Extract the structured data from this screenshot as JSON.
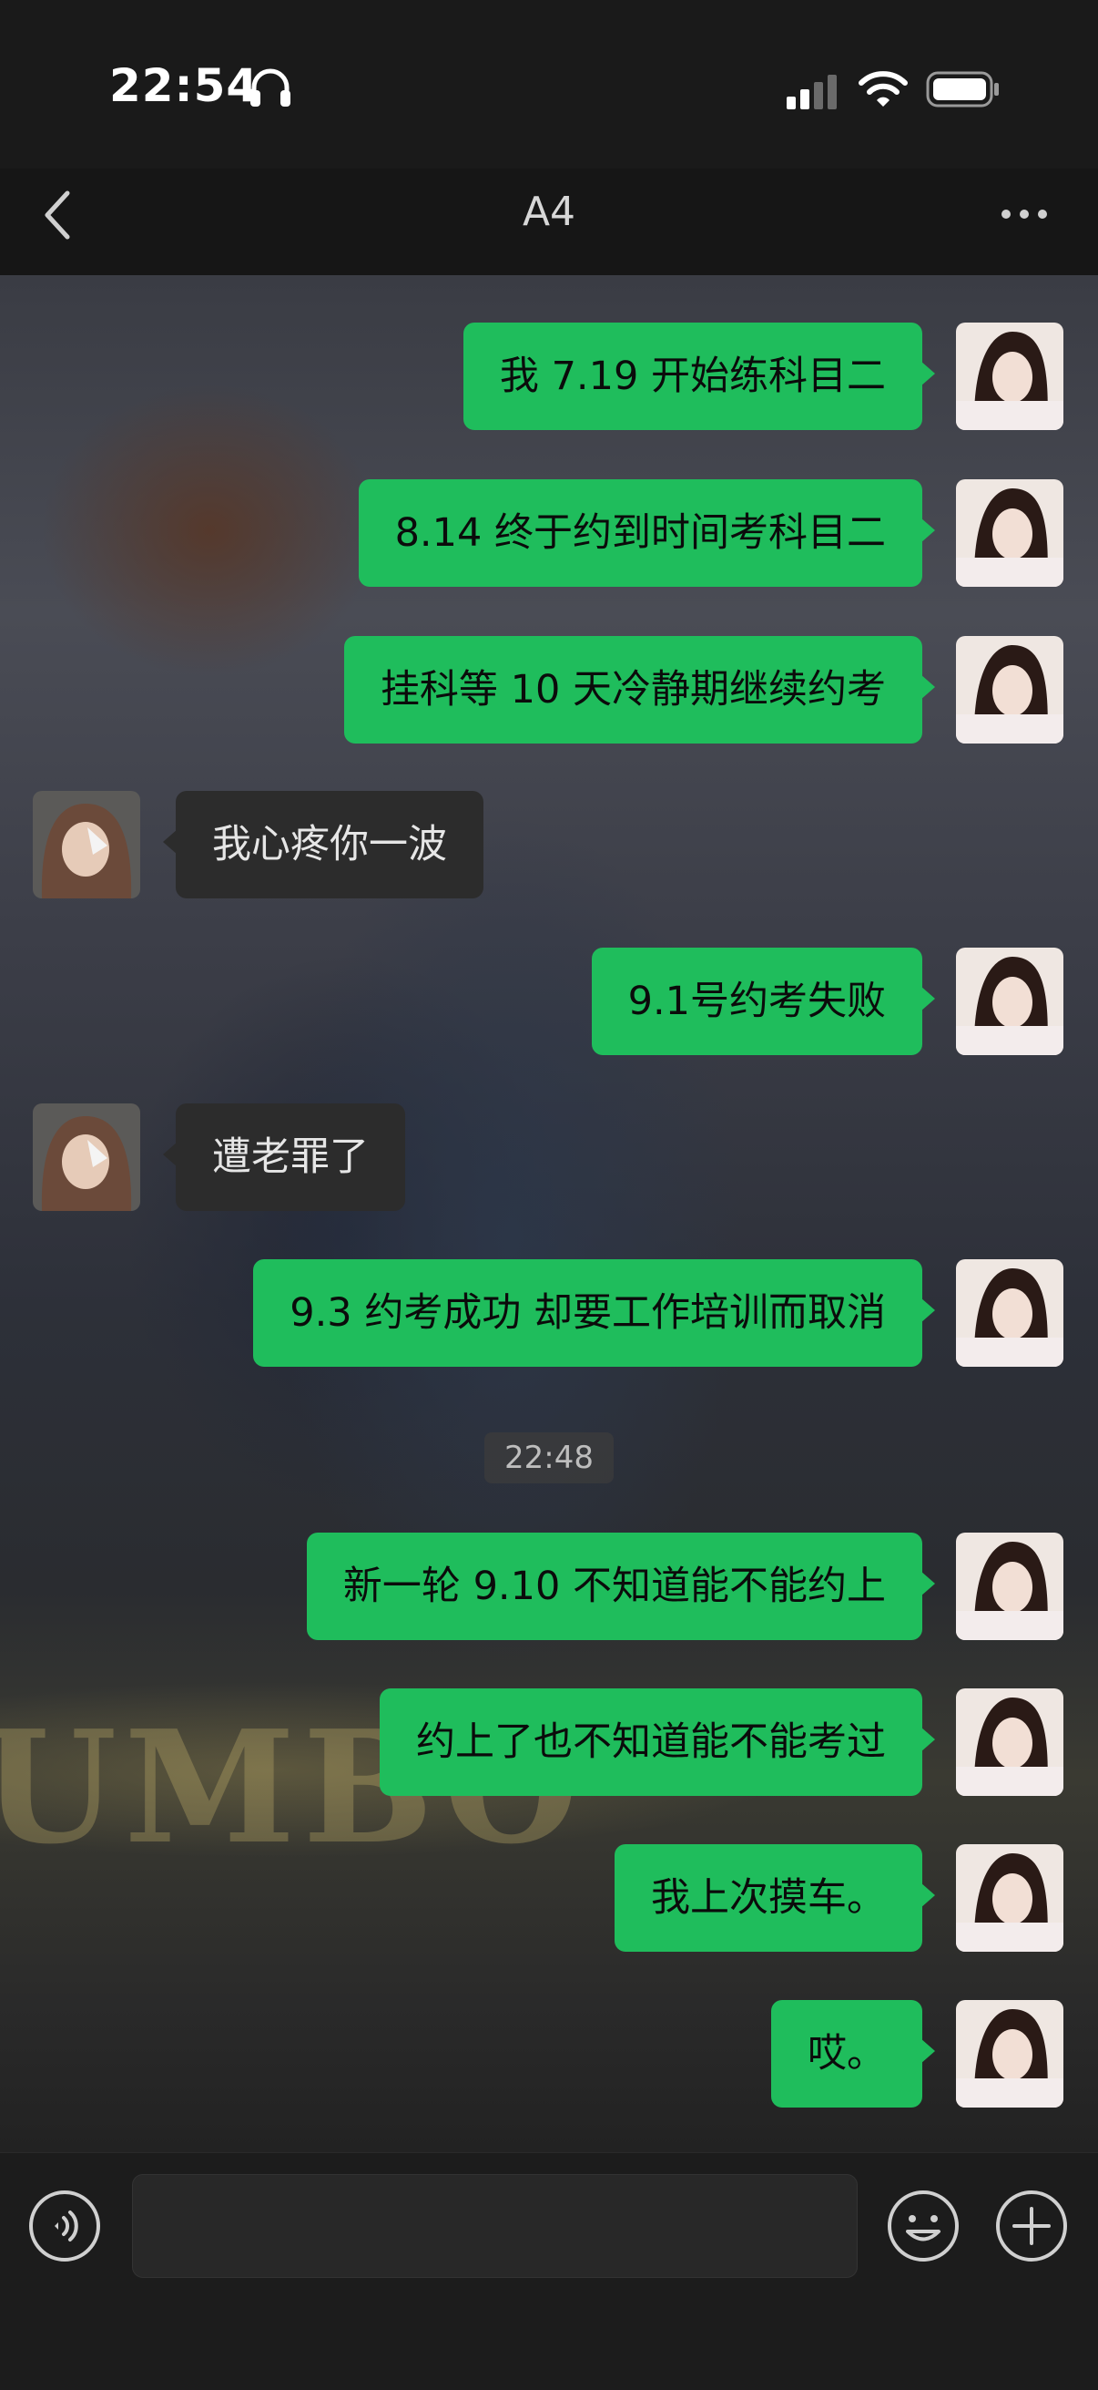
{
  "status_bar": {
    "time": "22:54"
  },
  "nav": {
    "title": "A4"
  },
  "messages": [
    {
      "side": "out",
      "text": "我 7.19 开始练科目二"
    },
    {
      "side": "out",
      "text": "8.14 终于约到时间考科目二"
    },
    {
      "side": "out",
      "text": "挂科等 10 天冷静期继续约考"
    },
    {
      "side": "in",
      "text": "我心疼你一波"
    },
    {
      "side": "out",
      "text": "9.1号约考失败"
    },
    {
      "side": "in",
      "text": "遭老罪了"
    },
    {
      "side": "out",
      "text": "9.3 约考成功 却要工作培训而取消"
    },
    {
      "side": "out",
      "text": "新一轮 9.10 不知道能不能约上"
    },
    {
      "side": "out",
      "text": "约上了也不知道能不能考过"
    },
    {
      "side": "out",
      "text": "我上次摸车。"
    },
    {
      "side": "out",
      "text": "哎。"
    }
  ],
  "timestamp": "22:48",
  "wallpaper_text": "UMBO",
  "colors": {
    "outgoing_bubble": "#1fbd5c",
    "incoming_bubble": "#2c2c2c",
    "background": "#161616"
  },
  "icons": [
    "headphones-icon",
    "signal-icon",
    "wifi-icon",
    "battery-icon",
    "back-chevron-icon",
    "more-icon",
    "voice-icon",
    "emoji-icon",
    "plus-icon"
  ]
}
